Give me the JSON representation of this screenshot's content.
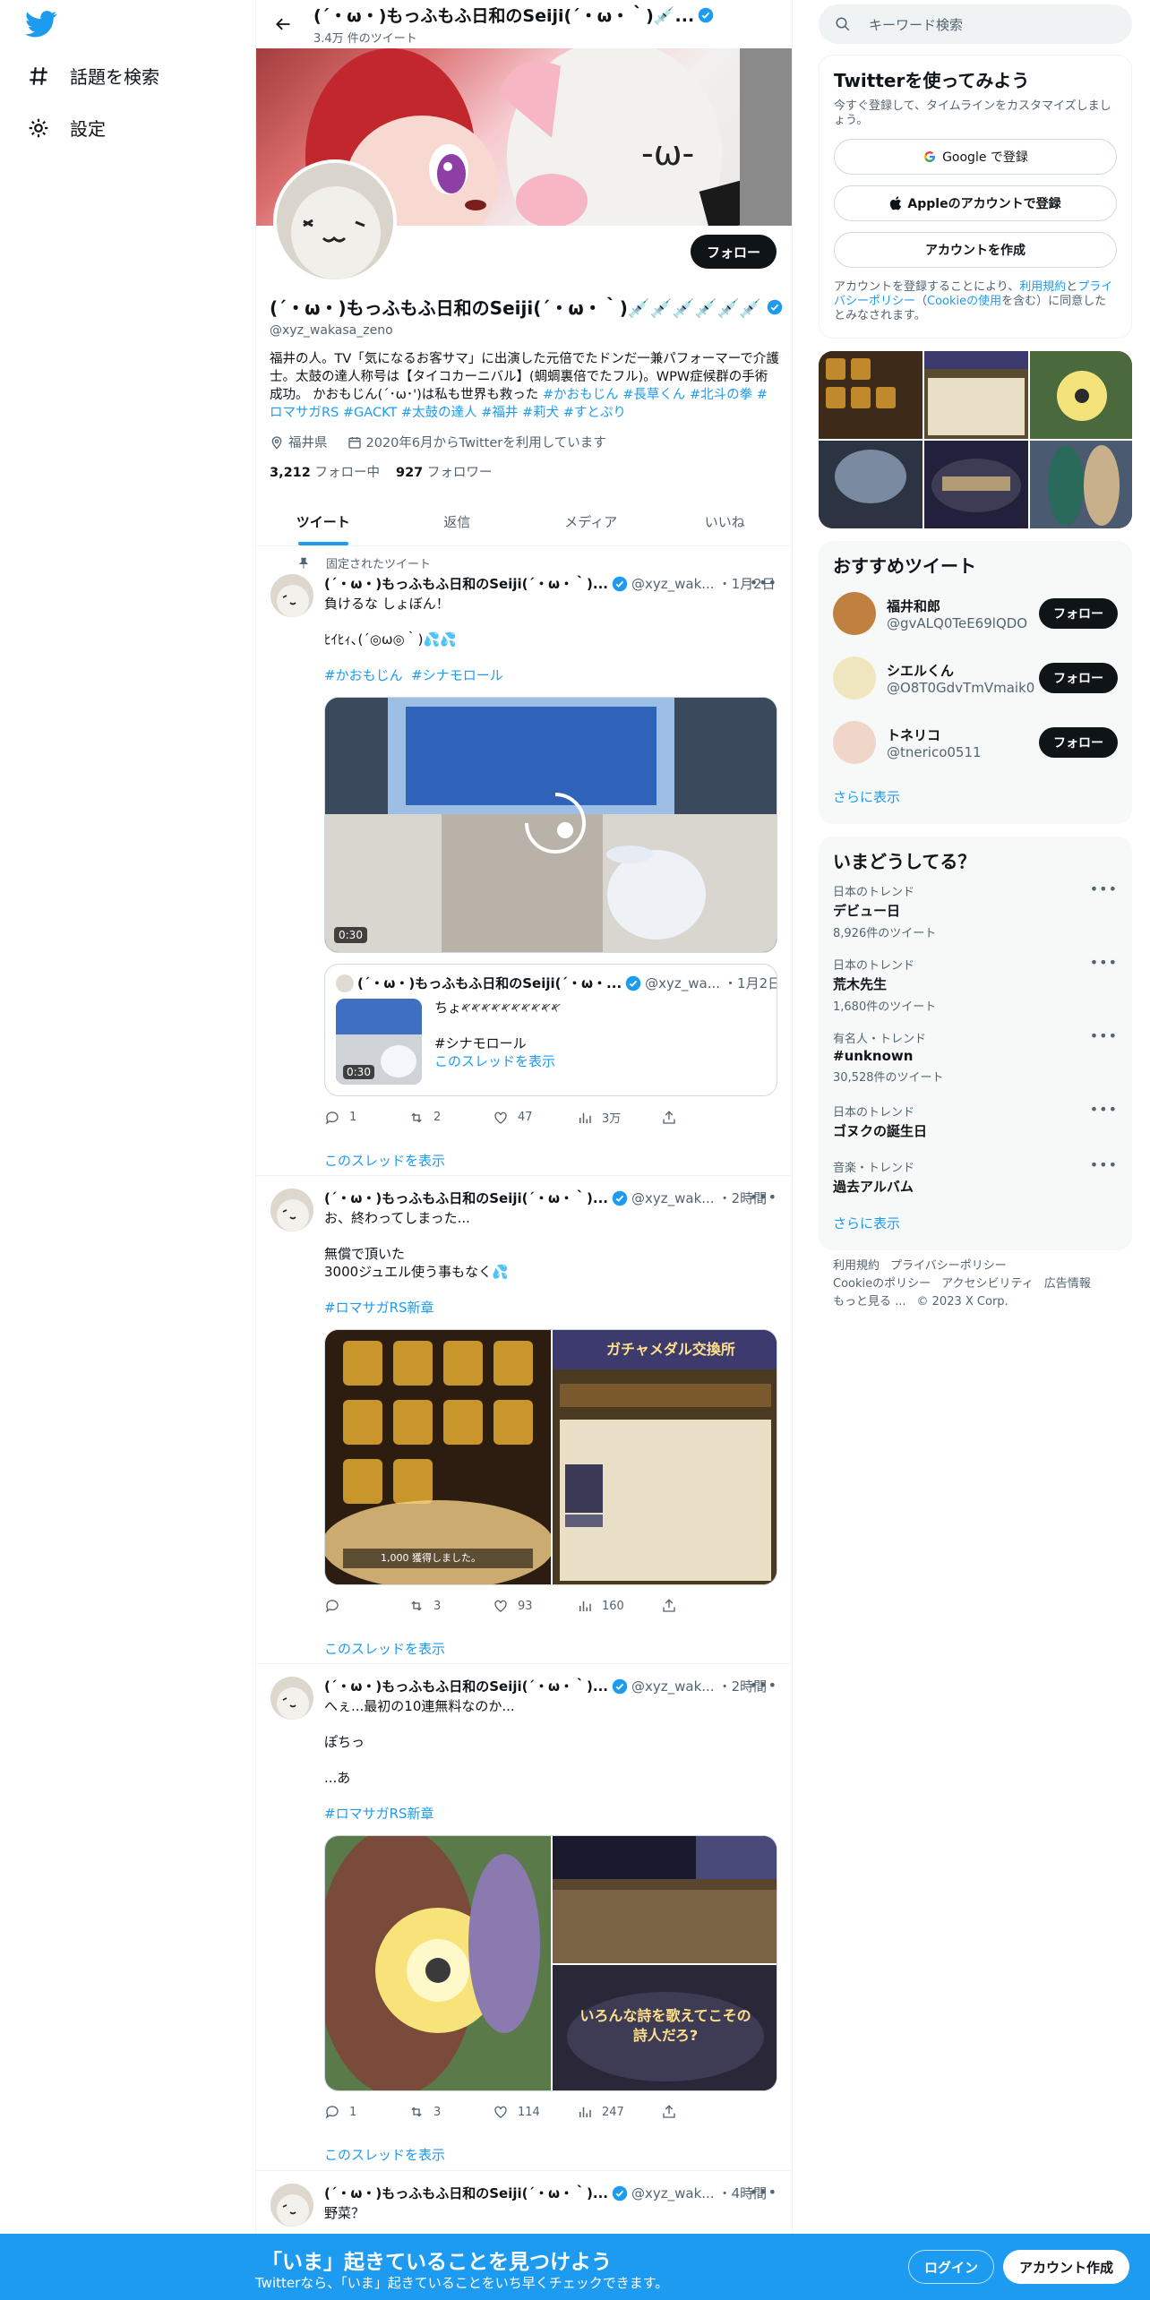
{
  "nav": {
    "items": [
      {
        "label": "話題を検索",
        "icon": "hashtag-icon"
      },
      {
        "label": "設定",
        "icon": "gear-icon"
      }
    ]
  },
  "header": {
    "title": "(´・ω・)もっふもふ日和のSeiji(´・ω・｀)💉...",
    "tweet_count": "3.4万 件のツイート"
  },
  "profile": {
    "name": "(´・ω・)もっふもふ日和のSeiji(´・ω・｀)💉💉💉💉💉💉",
    "handle": "@xyz_wakasa_zeno",
    "follow_label": "フォロー",
    "bio_text": "福井の人。TV「気になるお客サマ」に出演した元倍でたドンだ一兼パフォーマーで介護士。太鼓の達人称号は【タイコカーニバル】(蜩蜩裏倍でたフル)。WPW症候群の手術成功。 かおもじん(´･ω･')は私も世界も救った",
    "bio_tags": [
      "#かおもじん",
      "#長草くん",
      "#北斗の拳",
      "#ロマサガRS",
      "#GACKT",
      "#太鼓の達人",
      "#福井",
      "#莉犬",
      "#すとぷり"
    ],
    "location": "福井県",
    "joined": "2020年6月からTwitterを利用しています",
    "following_count": "3,212",
    "following_label": "フォロー中",
    "followers_count": "927",
    "followers_label": "フォロワー"
  },
  "tabs": [
    "ツイート",
    "返信",
    "メディア",
    "いいね"
  ],
  "tweets": [
    {
      "pinned_label": "固定されたツイート",
      "name": "(´・ω・)もっふもふ日和のSeiji(´・ω・｀)...",
      "handle": "@xyz_wak...",
      "time": "・1月2日",
      "text1": "負けるな しょぼん！",
      "text2": "ﾋｲﾋｨ､(´◎ω◎｀)💦💦",
      "tags": [
        "#かおもじん",
        "#シナモロール"
      ],
      "video_time": "0:30",
      "quote": {
        "name": "(´・ω・)もっふもふ日和のSeiji(´・ω・...",
        "handle": "@xyz_wa...",
        "time": "・1月2日",
        "text": "ちょ𐤀𐤀𐤀𐤀𐤀𐤀𐤀𐤀𐤀𐤀",
        "tag": "#シナモロール",
        "thread_link": "このスレッドを表示",
        "video_time": "0:30"
      },
      "replies": "1",
      "retweets": "2",
      "likes": "47",
      "views": "3万",
      "thread_link": "このスレッドを表示"
    },
    {
      "name": "(´・ω・)もっふもふ日和のSeiji(´・ω・｀)...",
      "handle": "@xyz_wak...",
      "time": "・2時間",
      "text1": "お、終わってしまった...",
      "text2": "無償で頂いた",
      "text3": "3000ジュエル使う事もなく💦",
      "tag": "#ロマサガRS新章",
      "img_caption": "1,000 獲得しました。",
      "img_title": "ガチャメダル交換所",
      "replies": "",
      "retweets": "3",
      "likes": "93",
      "views": "160",
      "thread_link": "このスレッドを表示"
    },
    {
      "name": "(´・ω・)もっふもふ日和のSeiji(´・ω・｀)...",
      "handle": "@xyz_wak...",
      "time": "・2時間",
      "text1": "へぇ...最初の10連無料なのか...",
      "text2": "ぽちっ",
      "text3": "...あ",
      "tag": "#ロマサガRS新章",
      "img_text": "いろんな詩を歌えてこその詩人だろ?",
      "replies": "1",
      "retweets": "3",
      "likes": "114",
      "views": "247",
      "thread_link": "このスレッドを表示"
    },
    {
      "name": "(´・ω・)もっふもふ日和のSeiji(´・ω・｀)...",
      "handle": "@xyz_wak...",
      "time": "・4時間",
      "text1": "野菜？"
    }
  ],
  "right": {
    "search_placeholder": "キーワード検索",
    "signup_title": "Twitterを使ってみよう",
    "signup_sub": "今すぐ登録して、タイムラインをカスタマイズしましょう。",
    "google_btn": "Google で登録",
    "apple_btn": "Appleのアカウントで登録",
    "create_btn": "アカウントを作成",
    "terms_pre": "アカウントを登録することにより、",
    "terms_link1": "利用規約",
    "terms_mid1": "と",
    "terms_link2": "プライバシーポリシー",
    "terms_mid2": "（",
    "terms_link3": "Cookieの使用",
    "terms_post": "を含む）に同意したとみなされます。",
    "rec_title": "おすすめツイート",
    "recs": [
      {
        "name": "福井和郎",
        "handle": "@gvALQ0TeE69lQDO",
        "btn": "フォロー"
      },
      {
        "name": "シエルくん",
        "handle": "@O8T0GdvTmVmaik0",
        "btn": "フォロー"
      },
      {
        "name": "トネリコ",
        "handle": "@tnerico0511",
        "btn": "フォロー"
      }
    ],
    "show_more": "さらに表示",
    "trends_title": "いまどうしてる？",
    "trends": [
      {
        "cat": "日本のトレンド",
        "name": "デビュー日",
        "count": "8,926件のツイート"
      },
      {
        "cat": "日本のトレンド",
        "name": "荒木先生",
        "count": "1,680件のツイート"
      },
      {
        "cat": "有名人・トレンド",
        "name": "#unknown",
        "count": "30,528件のツイート"
      },
      {
        "cat": "日本のトレンド",
        "name": "ゴヌクの誕生日",
        "count": ""
      },
      {
        "cat": "音楽・トレンド",
        "name": "過去アルバム",
        "count": ""
      }
    ],
    "footer": [
      "利用規約",
      "プライバシーポリシー",
      "Cookieのポリシー",
      "アクセシビリティ",
      "広告情報",
      "もっと見る ...",
      "© 2023 X Corp."
    ]
  },
  "bottom": {
    "title": "「いま」起きていることを見つけよう",
    "sub": "Twitterなら、「いま」起きていることをいち早くチェックできます。",
    "login": "ログイン",
    "signup": "アカウント作成"
  },
  "colors": {
    "accent": "#1d9bf0",
    "text": "#0f1419",
    "muted": "#536471"
  }
}
